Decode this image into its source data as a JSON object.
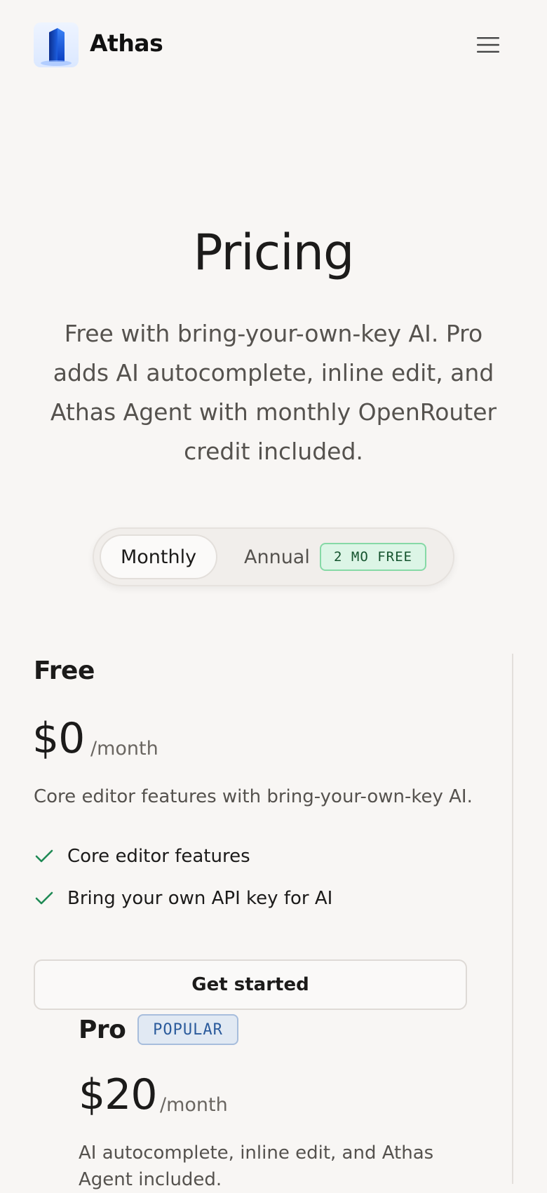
{
  "header": {
    "brand_name": "Athas",
    "logo_icon": "athas-logo-icon",
    "menu_icon": "hamburger-menu-icon"
  },
  "hero": {
    "title": "Pricing",
    "subtitle": "Free with bring-your-own-key AI. Pro adds AI autocomplete, inline edit, and Athas Agent with monthly OpenRouter credit included."
  },
  "billing_toggle": {
    "monthly_label": "Monthly",
    "annual_label": "Annual",
    "annual_badge": "2 MO FREE",
    "selected": "Monthly"
  },
  "plans": [
    {
      "name": "Free",
      "price": "$0",
      "period": "/month",
      "description": "Core editor features with bring-your-own-key AI.",
      "features": [
        "Core editor features",
        "Bring your own API key for AI"
      ],
      "cta_label": "Get started"
    },
    {
      "name": "Pro",
      "badge": "POPULAR",
      "price": "$20",
      "period": "/month",
      "description": "AI autocomplete, inline edit, and Athas Agent included."
    }
  ],
  "colors": {
    "background": "#f8f6f4",
    "check": "#1f8a55",
    "promo_badge_bg": "#dcf5e6",
    "popular_badge_bg": "#e1e9f3"
  }
}
